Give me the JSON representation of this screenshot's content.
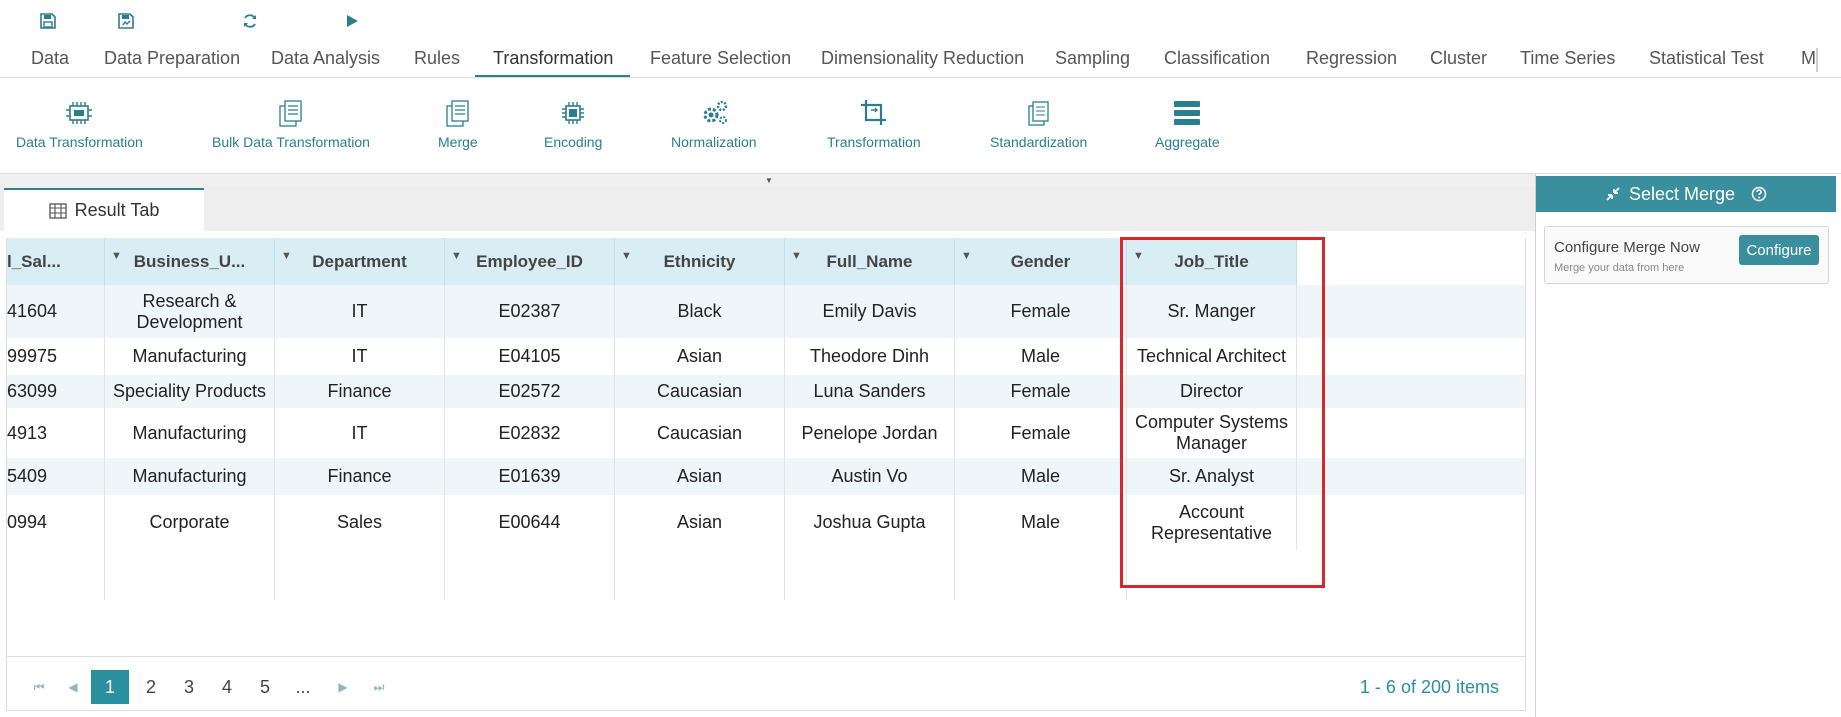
{
  "toolbar": {
    "icons": [
      "save-icon",
      "save-as-icon",
      "refresh-icon",
      "run-icon"
    ]
  },
  "menu": {
    "items": [
      "Data",
      "Data Preparation",
      "Data Analysis",
      "Rules",
      "Transformation",
      "Feature Selection",
      "Dimensionality Reduction",
      "Sampling",
      "Classification",
      "Regression",
      "Cluster",
      "Time Series",
      "Statistical Test",
      "M"
    ],
    "active": "Transformation"
  },
  "ribbon": {
    "items": [
      "Data Transformation",
      "Bulk Data Transformation",
      "Merge",
      "Encoding",
      "Normalization",
      "Transformation",
      "Standardization",
      "Aggregate"
    ]
  },
  "result_tab": {
    "label": "Result Tab"
  },
  "grid": {
    "columns": [
      "l_Sal...",
      "Business_U...",
      "Department",
      "Employee_ID",
      "Ethnicity",
      "Full_Name",
      "Gender",
      "Job_Title"
    ],
    "rows": [
      [
        "41604",
        "Research & Development",
        "IT",
        "E02387",
        "Black",
        "Emily Davis",
        "Female",
        "Sr. Manger"
      ],
      [
        "99975",
        "Manufacturing",
        "IT",
        "E04105",
        "Asian",
        "Theodore Dinh",
        "Male",
        "Technical Architect"
      ],
      [
        "63099",
        "Speciality Products",
        "Finance",
        "E02572",
        "Caucasian",
        "Luna Sanders",
        "Female",
        "Director"
      ],
      [
        "4913",
        "Manufacturing",
        "IT",
        "E02832",
        "Caucasian",
        "Penelope Jordan",
        "Female",
        "Computer Systems Manager"
      ],
      [
        "5409",
        "Manufacturing",
        "Finance",
        "E01639",
        "Asian",
        "Austin Vo",
        "Male",
        "Sr. Analyst"
      ],
      [
        "0994",
        "Corporate",
        "Sales",
        "E00644",
        "Asian",
        "Joshua Gupta",
        "Male",
        "Account Representative"
      ]
    ],
    "highlighted_column": "Gender"
  },
  "pager": {
    "pages": [
      "1",
      "2",
      "3",
      "4",
      "5",
      "..."
    ],
    "current": "1",
    "info": "1 - 6 of 200 items"
  },
  "right_panel": {
    "title": "Select Merge",
    "card_title": "Configure Merge Now",
    "card_subtitle": "Merge your data from here",
    "button": "Configure"
  },
  "colors": {
    "accent": "#2a7f8f",
    "header_bg": "#d9edf5",
    "highlight": "#d9262e"
  }
}
